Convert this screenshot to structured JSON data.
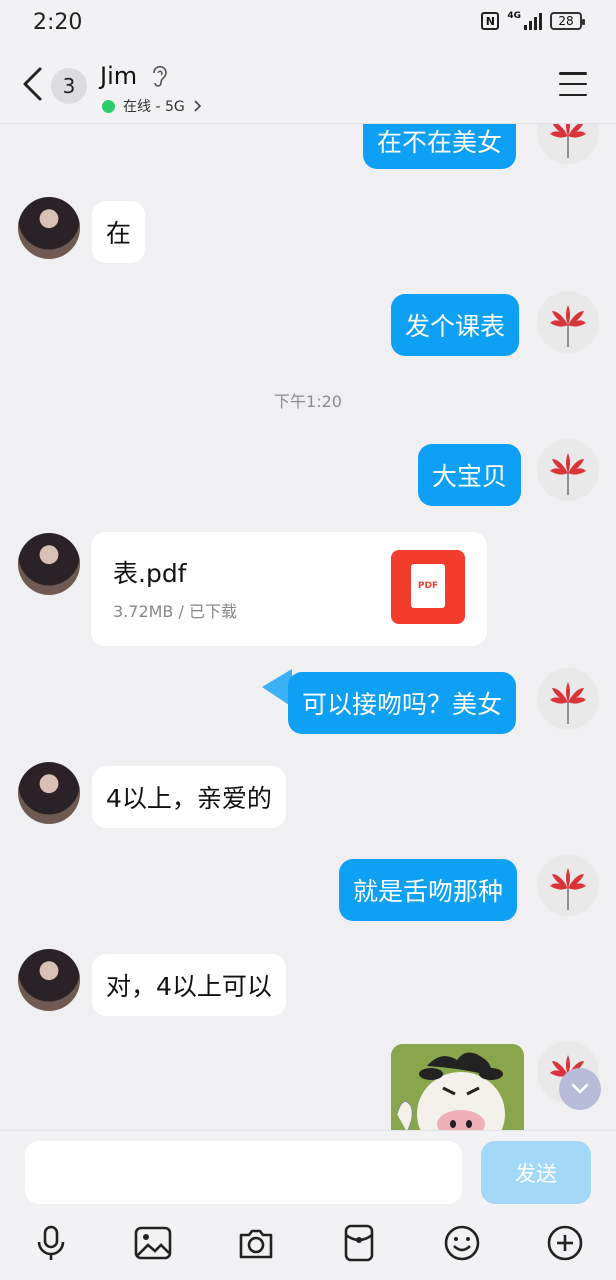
{
  "status_bar": {
    "time": "2:20",
    "network_label": "4G",
    "battery": "28"
  },
  "header": {
    "unread_count": "3",
    "contact_name": "Jim",
    "online_status": "在线 - 5G",
    "online_color": "#2ccc6a"
  },
  "messages": [
    {
      "direction": "out",
      "text": "在不在美女"
    },
    {
      "direction": "in",
      "text": "在"
    },
    {
      "direction": "out",
      "text": "发个课表"
    },
    {
      "type": "time",
      "text": "下午1:20"
    },
    {
      "direction": "out",
      "text": "大宝贝"
    },
    {
      "direction": "in",
      "type": "file",
      "file_name": "表.pdf",
      "file_meta": "3.72MB / 已下载",
      "icon_label": "PDF"
    },
    {
      "direction": "out",
      "text": "可以接吻吗？美女"
    },
    {
      "direction": "in",
      "text": "4以上，亲爱的"
    },
    {
      "direction": "out",
      "text": "就是舌吻那种"
    },
    {
      "direction": "in",
      "text": "对，4以上可以"
    },
    {
      "direction": "out",
      "type": "sticker",
      "icon": "cow-sticker"
    }
  ],
  "input": {
    "placeholder": "",
    "send_label": "发送"
  },
  "toolbar": {
    "items": [
      "microphone-icon",
      "image-icon",
      "camera-icon",
      "red-packet-icon",
      "emoji-icon",
      "plus-icon"
    ]
  },
  "colors": {
    "outgoing_bubble": "#0ea0f5",
    "incoming_bubble": "#ffffff",
    "send_disabled": "#a4d8f8"
  }
}
